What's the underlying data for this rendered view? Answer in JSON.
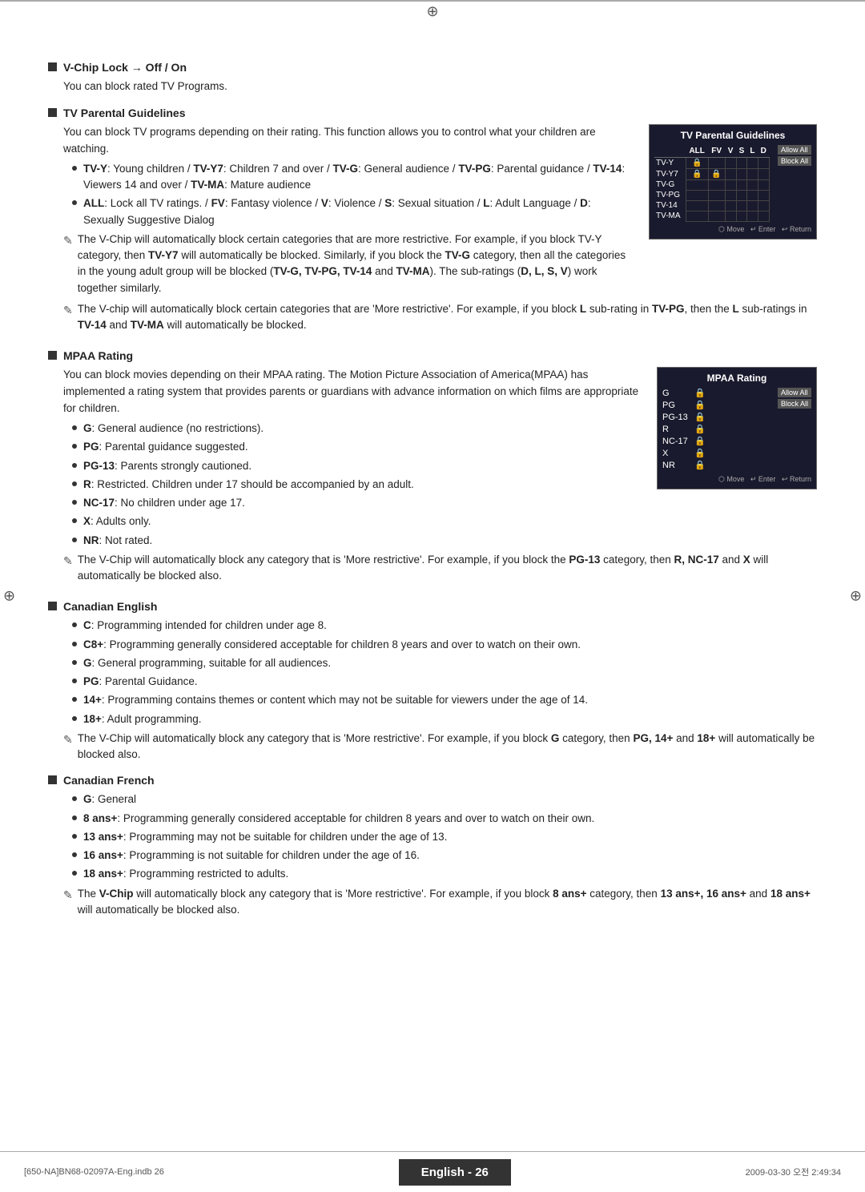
{
  "page": {
    "title": "English 26",
    "footer_left": "[650-NA]BN68-02097A-Eng.indb  26",
    "footer_right": "2009-03-30  오전  2:49:34",
    "footer_badge": "English - 26"
  },
  "sections": {
    "vchip": {
      "title": "V-Chip Lock → Off / On",
      "body": "You can block rated TV Programs."
    },
    "tv_parental": {
      "title": "TV Parental Guidelines",
      "body": "You can block TV programs depending on their rating. This function allows you to control what your children are watching.",
      "bullets": [
        "TV-Y: Young children / TV-Y7: Children 7 and over / TV-G: General audience / TV-PG: Parental guidance / TV-14: Viewers 14 and over / TV-MA: Mature audience",
        "ALL: Lock all TV ratings. / FV: Fantasy violence / V: Violence / S: Sexual situation / L: Adult Language / D: Sexually Suggestive Dialog"
      ],
      "notes": [
        "The V-Chip will automatically block certain categories that are more restrictive. For example, if you block TV-Y category, then TV-Y7 will automatically be blocked. Similarly, if you block the TV-G category, then all the categories in the young adult group will be blocked (TV-G, TV-PG, TV-14 and TV-MA). The sub-ratings (D, L, S, V) work together similarly.",
        "The V-chip will automatically block certain categories that are 'More restrictive'. For example, if you block L sub-rating in TV-PG, then the L sub-ratings in TV-14 and TV-MA will automatically be blocked."
      ],
      "panel": {
        "title": "TV Parental Guidelines",
        "columns": [
          "ALL",
          "FV",
          "V",
          "S",
          "L",
          "D"
        ],
        "rows": [
          {
            "label": "TV-Y",
            "locked": [
              true,
              false,
              false,
              false,
              false,
              false
            ]
          },
          {
            "label": "TV-Y7",
            "locked": [
              true,
              true,
              false,
              false,
              false,
              false
            ]
          },
          {
            "label": "TV-G",
            "locked": [
              false,
              false,
              false,
              false,
              false,
              false
            ]
          },
          {
            "label": "TV-PG",
            "locked": [
              false,
              false,
              false,
              false,
              false,
              false
            ]
          },
          {
            "label": "TV-14",
            "locked": [
              false,
              false,
              false,
              false,
              false,
              false
            ]
          },
          {
            "label": "TV-MA",
            "locked": [
              false,
              false,
              false,
              false,
              false,
              false
            ]
          }
        ],
        "btn_allow": "Allow All",
        "btn_block": "Block All",
        "nav": "Move   Enter   Return"
      }
    },
    "mpaa": {
      "title": "MPAA Rating",
      "body": "You can block movies depending on their MPAA rating. The Motion Picture Association of America(MPAA) has implemented a rating system that provides parents or guardians with advance information on which films are appropriate for children.",
      "bullets": [
        "G: General audience (no restrictions).",
        "PG: Parental guidance suggested.",
        "PG-13: Parents strongly cautioned.",
        "R: Restricted. Children under 17 should be accompanied by an adult.",
        "NC-17: No children under age 17.",
        "X: Adults only.",
        "NR: Not rated."
      ],
      "note": "The V-Chip will automatically block any category that is 'More restrictive'. For example, if you block the PG-13 category, then R, NC-17 and X will automatically be blocked also.",
      "panel": {
        "title": "MPAA Rating",
        "rows": [
          "G",
          "PG",
          "PG-13",
          "R",
          "NC-17",
          "X",
          "NR"
        ],
        "btn_allow": "Allow All",
        "btn_block": "Block All",
        "nav": "Move   Enter   Return"
      }
    },
    "canadian_english": {
      "title": "Canadian English",
      "bullets": [
        "C: Programming intended for children under age 8.",
        "C8+: Programming generally considered acceptable for children 8 years and over to watch on their own.",
        "G: General programming, suitable for all audiences.",
        "PG: Parental Guidance.",
        "14+: Programming contains themes or content which may not be suitable for viewers under the age of 14.",
        "18+: Adult programming."
      ],
      "note": "The V-Chip will automatically block any category that is 'More restrictive'. For example, if you block G category, then PG, 14+ and 18+ will automatically be blocked also."
    },
    "canadian_french": {
      "title": "Canadian French",
      "bullets": [
        "G: General",
        "8 ans+: Programming generally considered acceptable for children 8 years and over to watch on their own.",
        "13 ans+: Programming may not be suitable for children under the age of 13.",
        "16 ans+: Programming is not suitable for children under the age of 16.",
        "18 ans+: Programming restricted to adults."
      ],
      "note": "The V-Chip will automatically block any category that is 'More restrictive'. For example, if you block 8 ans+ category, then 13 ans+, 16 ans+ and 18 ans+ will automatically be blocked also."
    }
  }
}
